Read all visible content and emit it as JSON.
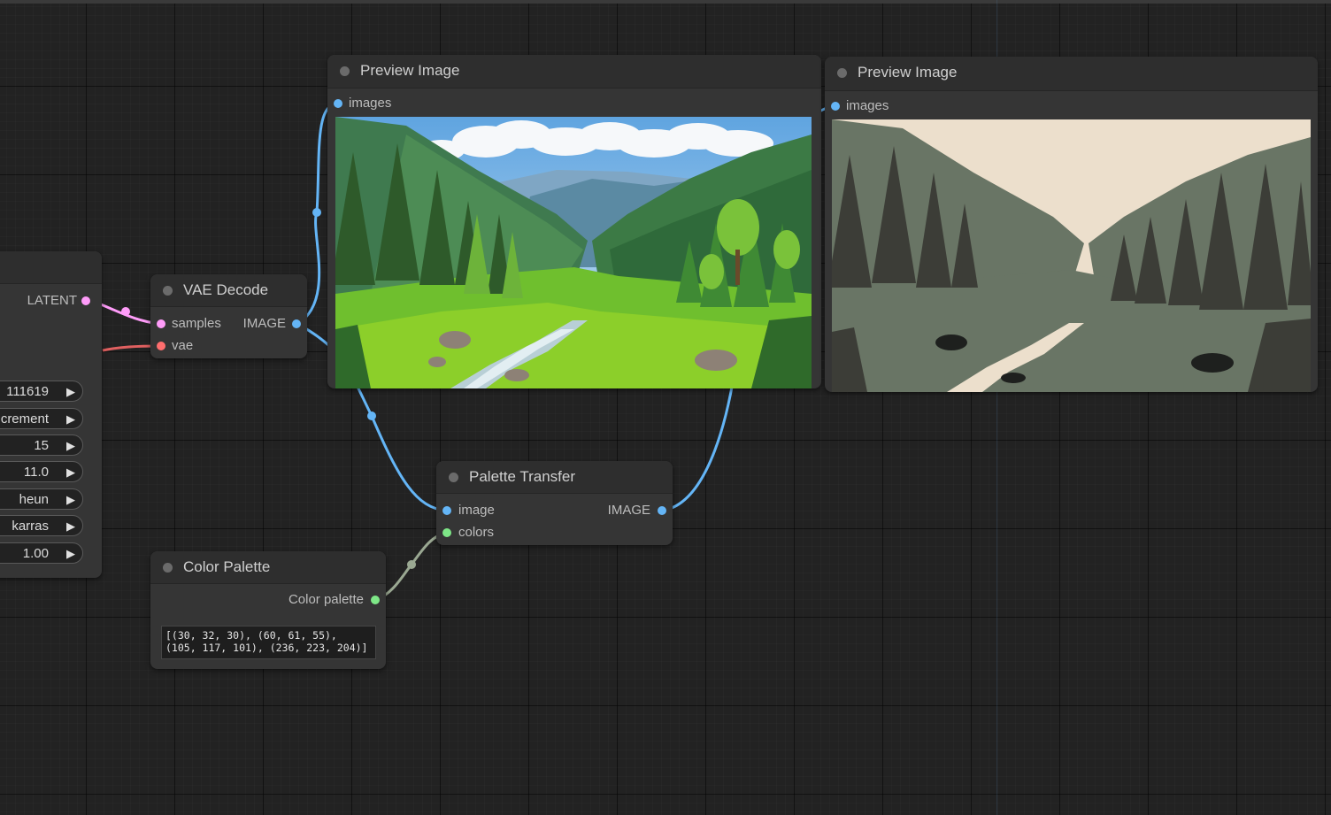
{
  "ksampler": {
    "output_label": "LATENT",
    "widgets": [
      "111619",
      "crement",
      "15",
      "11.0",
      "heun",
      "karras",
      "1.00"
    ]
  },
  "vae_decode": {
    "title": "VAE Decode",
    "input_samples": "samples",
    "input_vae": "vae",
    "output_image": "IMAGE"
  },
  "preview_1": {
    "title": "Preview Image",
    "input_images": "images"
  },
  "preview_2": {
    "title": "Preview Image",
    "input_images": "images"
  },
  "palette_transfer": {
    "title": "Palette Transfer",
    "input_image": "image",
    "input_colors": "colors",
    "output_image": "IMAGE"
  },
  "color_palette": {
    "title": "Color Palette",
    "output_label": "Color palette",
    "text": "[(30, 32, 30), (60, 61, 55),\n(105, 117, 101), (236, 223, 204)]"
  },
  "colors": {
    "latent": "#ff9cf9",
    "vae": "#ff6e6e",
    "image": "#64b5f6",
    "colors_link": "#9aa892",
    "colors_dot": "#7ee787",
    "palette": [
      "#1e201e",
      "#3c3d37",
      "#697565",
      "#ecdfcc"
    ]
  }
}
